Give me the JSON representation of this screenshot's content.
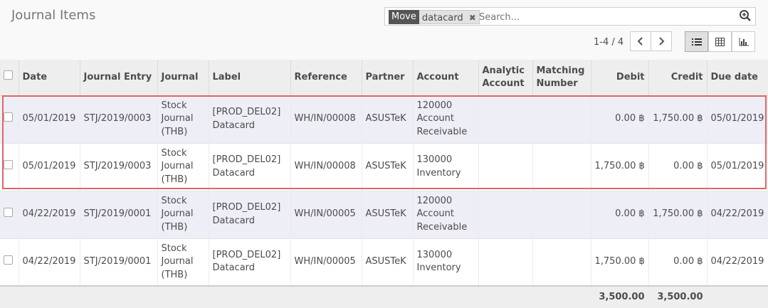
{
  "page": {
    "title": "Journal Items"
  },
  "search": {
    "facet_label": "Move",
    "facet_value": "datacard",
    "facet_remove": "✖",
    "placeholder": "Search..."
  },
  "pager": {
    "value": "1-4 / 4"
  },
  "views": [
    "list-view",
    "pivot-view",
    "graph-view"
  ],
  "columns": [
    "Date",
    "Journal Entry",
    "Journal",
    "Label",
    "Reference",
    "Partner",
    "Account",
    "Analytic Account",
    "Matching Number",
    "Debit",
    "Credit",
    "Due date"
  ],
  "columns_wrapped": {
    "analytic": [
      "Analytic",
      "Account"
    ],
    "matching": [
      "Matching",
      "Number"
    ]
  },
  "rows": [
    {
      "date": "05/01/2019",
      "entry": "STJ/2019/0003",
      "journal": [
        "Stock",
        "Journal",
        "(THB)"
      ],
      "label": [
        "[PROD_DEL02]",
        "Datacard"
      ],
      "reference": "WH/IN/00008",
      "partner": "ASUSTeK",
      "account": [
        "120000",
        "Account",
        "Receivable"
      ],
      "analytic": "",
      "matching": "",
      "debit": "0.00 ฿",
      "credit": "1,750.00 ฿",
      "due": "05/01/2019"
    },
    {
      "date": "05/01/2019",
      "entry": "STJ/2019/0003",
      "journal": [
        "Stock",
        "Journal",
        "(THB)"
      ],
      "label": [
        "[PROD_DEL02]",
        "Datacard"
      ],
      "reference": "WH/IN/00008",
      "partner": "ASUSTeK",
      "account": [
        "130000",
        "Inventory"
      ],
      "analytic": "",
      "matching": "",
      "debit": "1,750.00 ฿",
      "credit": "0.00 ฿",
      "due": "05/01/2019"
    },
    {
      "date": "04/22/2019",
      "entry": "STJ/2019/0001",
      "journal": [
        "Stock",
        "Journal",
        "(THB)"
      ],
      "label": [
        "[PROD_DEL02]",
        "Datacard"
      ],
      "reference": "WH/IN/00005",
      "partner": "ASUSTeK",
      "account": [
        "120000",
        "Account",
        "Receivable"
      ],
      "analytic": "",
      "matching": "",
      "debit": "0.00 ฿",
      "credit": "1,750.00 ฿",
      "due": "04/22/2019"
    },
    {
      "date": "04/22/2019",
      "entry": "STJ/2019/0001",
      "journal": [
        "Stock",
        "Journal",
        "(THB)"
      ],
      "label": [
        "[PROD_DEL02]",
        "Datacard"
      ],
      "reference": "WH/IN/00005",
      "partner": "ASUSTeK",
      "account": [
        "130000",
        "Inventory"
      ],
      "analytic": "",
      "matching": "",
      "debit": "1,750.00 ฿",
      "credit": "0.00 ฿",
      "due": "04/22/2019"
    }
  ],
  "totals": {
    "debit": "3,500.00",
    "credit": "3,500.00"
  },
  "colors": {
    "highlight": "#e06666",
    "odd_row": "#eeeef6"
  }
}
